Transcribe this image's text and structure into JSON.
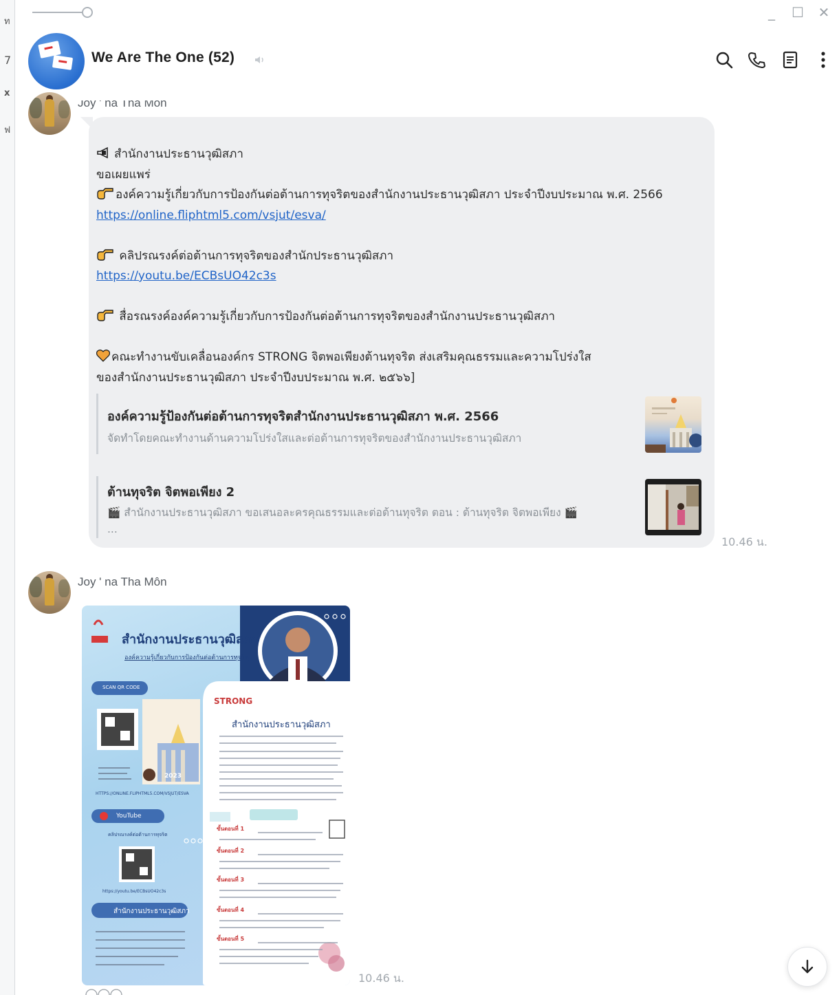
{
  "edge": {
    "chars": [
      "ท",
      "7",
      "x",
      "ฟ"
    ]
  },
  "window": {
    "minimize": "_",
    "maximize": "☐",
    "close": "✕"
  },
  "header": {
    "title": "We Are The One (52)"
  },
  "messages": [
    {
      "sender": "Joy ' na Tha Môn",
      "time": "10.46 น.",
      "text_lines": [
        {
          "emoji": "megaphone",
          "text": "สำนักงานประธานวุฒิสภา"
        },
        {
          "emoji": "",
          "text": "ขอเผยแพร่"
        },
        {
          "emoji": "pointing-hand",
          "text": "องค์ความรู้เกี่ยวกับการป้องกันต่อต้านการทุจริตของสำนักงานประธานวุฒิสภา ประจำปีงบประมาณ พ.ศ. 2566"
        },
        {
          "link": "https://online.fliphtml5.com/vsjut/esva/"
        },
        {
          "emoji": "pointing-hand",
          "text": " คลิปรณรงค์ต่อต้านการทุจริตของสำนักประธานวุฒิสภา"
        },
        {
          "link": "https://youtu.be/ECBsUO42c3s"
        },
        {
          "emoji": "pointing-hand",
          "text": " สื่อรณรงค์องค์ความรู้เกี่ยวกับการป้องกันต่อต้านการทุจริตของสำนักงานประธานวุฒิสภา"
        },
        {
          "emoji": "heart",
          "text": "คณะทำงานขับเคลื่อนองค์กร STRONG จิตพอเพียงต้านทุจริต ส่งเสริมคุณธรรมและความโปร่งใส"
        },
        {
          "emoji": "",
          "text": "ของสำนักงานประธานวุฒิสภา ประจำปีงบประมาณ พ.ศ. ๒๕๖๖]"
        }
      ],
      "previews": [
        {
          "title": "องค์ความรู้ป้องกันต่อต้านการทุจริตสำนักงานประธานวุฒิสภา พ.ศ. 2566",
          "desc": "จัดทำโดยคณะทำงานด้านความโปร่งใสและต่อต้านการทุจริตของสำนักงานประธานวุฒิสภา"
        },
        {
          "title": "ต้านทุจริต จิตพอเพียง 2",
          "desc": "สำนักงานประธานวุฒิสภา ขอเสนอละครคุณธรรมและต่อต้านทุจริต ตอน : ต้านทุจริต จิตพอเพียง",
          "desc2": "..."
        }
      ]
    },
    {
      "sender": "Joy ' na Tha Môn",
      "time": "10.46 น.",
      "poster": {
        "title": "สำนักงานประธานวุฒิสภา",
        "subtitle": "องค์ความรู้เกี่ยวกับการป้องกันต่อต้านการทุจริต",
        "scan_label": "SCAN QR CODE",
        "url1": "HTTPS://ONLINE.FLIPHTML5.COM/VSJUT/ESVA",
        "youtube_label": "YouTube",
        "youtube_caption": "คลิปรณรงค์ต่อต้านการทุจริต",
        "url2": "https://youtu.be/ECBsUO42c3s",
        "org_label": "สำนักงานประธานวุฒิสภา",
        "strong_label": "STRONG",
        "right_title": "สำนักงานประธานวุฒิสภา",
        "year": "2023",
        "steps": [
          "ขั้นตอนที่ 1",
          "ขั้นตอนที่ 2",
          "ขั้นตอนที่ 3",
          "ขั้นตอนที่ 4",
          "ขั้นตอนที่ 5"
        ]
      }
    }
  ],
  "colors": {
    "link": "#1f63c7",
    "bubble": "#eeeff1",
    "poster_navy": "#1f3f7a"
  }
}
